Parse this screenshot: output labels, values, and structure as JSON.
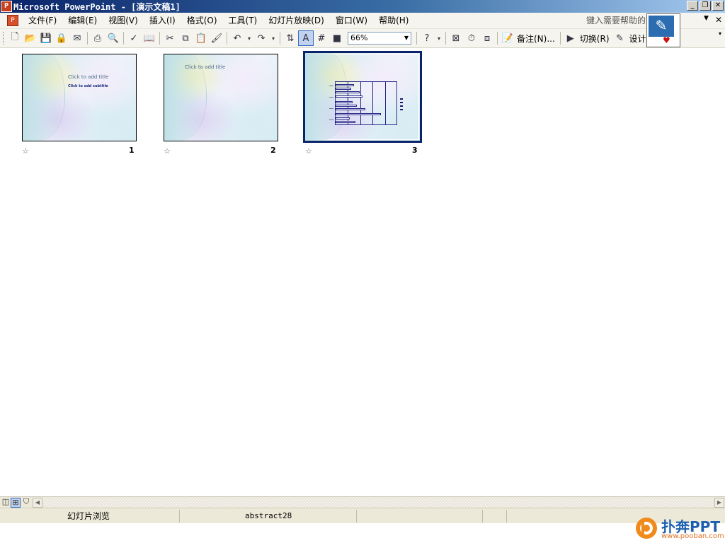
{
  "window": {
    "title": "Microsoft PowerPoint - [演示文稿1]",
    "controls": [
      "minimize-icon",
      "restore-icon",
      "close-icon"
    ]
  },
  "menubar": {
    "items": [
      "文件(F)",
      "编辑(E)",
      "视图(V)",
      "插入(I)",
      "格式(O)",
      "工具(T)",
      "幻灯片放映(D)",
      "窗口(W)",
      "帮助(H)"
    ],
    "help_placeholder": "键入需要帮助的问题"
  },
  "toolbar": {
    "zoom": "66%",
    "notes_label": "备注(N)...",
    "transition_label": "切换(R)",
    "design_label": "设计"
  },
  "slides": [
    {
      "number": "1",
      "title": "Click to add title",
      "subtitle": "Click to add subtitle"
    },
    {
      "number": "2",
      "title": "Click to add title"
    },
    {
      "number": "3",
      "selected": true
    }
  ],
  "statusbar": {
    "view": "幻灯片浏览",
    "template": "abstract28"
  },
  "watermark": {
    "name": "扑奔PPT",
    "url": "www.pooban.com"
  }
}
